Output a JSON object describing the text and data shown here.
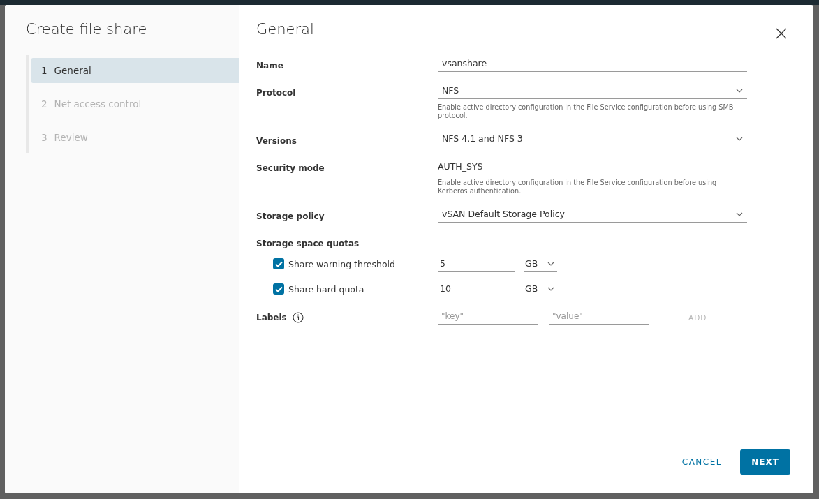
{
  "dialog": {
    "title": "Create file share",
    "steps": [
      {
        "number": "1",
        "label": "General",
        "selected": true,
        "disabled": false
      },
      {
        "number": "2",
        "label": "Net access control",
        "selected": false,
        "disabled": true
      },
      {
        "number": "3",
        "label": "Review",
        "selected": false,
        "disabled": true
      }
    ]
  },
  "page": {
    "title": "General",
    "fields": [
      {
        "kind": "text",
        "label": "Name",
        "value": "vsanshare"
      },
      {
        "kind": "select",
        "label": "Protocol",
        "value": "NFS",
        "help": "Enable active directory configuration in the File Service configuration before using SMB protocol."
      },
      {
        "kind": "select",
        "label": "Versions",
        "value": "NFS 4.1 and NFS 3"
      },
      {
        "kind": "static",
        "label": "Security mode",
        "value": "AUTH_SYS",
        "help": "Enable active directory configuration in the File Service configuration before using Kerberos authentication."
      },
      {
        "kind": "select",
        "label": "Storage policy",
        "value": "vSAN Default Storage Policy"
      }
    ],
    "quotas": {
      "label": "Storage space quotas",
      "items": [
        {
          "label": "Share warning threshold",
          "checked": true,
          "value": "5",
          "unit": "GB"
        },
        {
          "label": "Share hard quota",
          "checked": true,
          "value": "10",
          "unit": "GB"
        }
      ]
    },
    "labels": {
      "label": "Labels",
      "key_placeholder": "\"key\"",
      "value_placeholder": "\"value\"",
      "add_button": {
        "label": "ADD",
        "disabled": true
      }
    }
  },
  "buttons": {
    "cancel": "CANCEL",
    "next": "NEXT"
  }
}
